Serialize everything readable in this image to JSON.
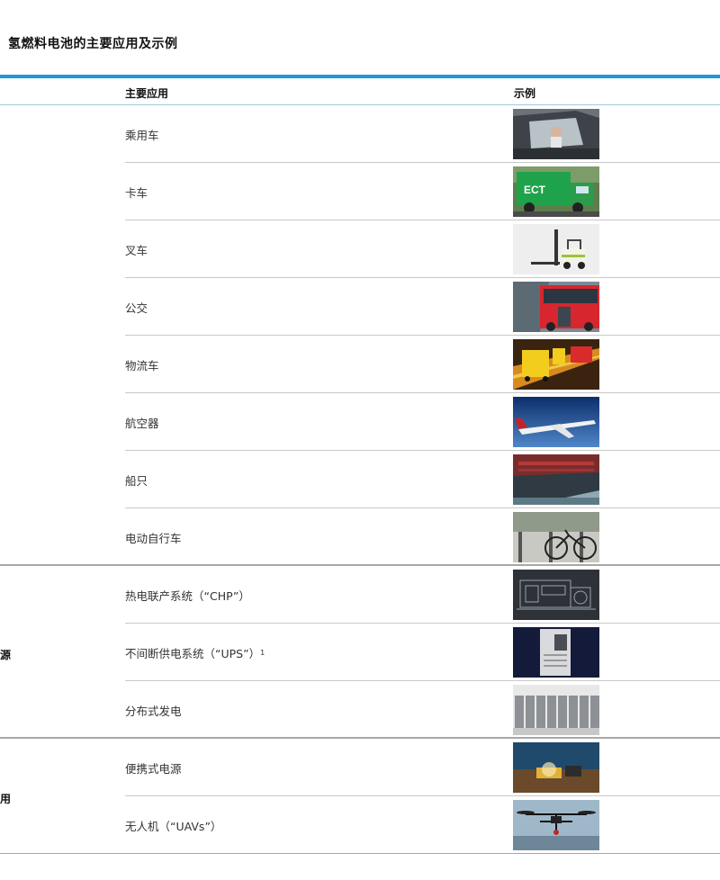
{
  "title": "氢燃料电池的主要应用及示例",
  "header": {
    "app_col": "主要应用",
    "example_col": "示例"
  },
  "categories": [
    {
      "label": "电源"
    },
    {
      "label": "应用"
    }
  ],
  "rows": [
    {
      "label": "乘用车",
      "icon": "car-image"
    },
    {
      "label": "卡车",
      "icon": "truck-image"
    },
    {
      "label": "叉车",
      "icon": "forklift-image"
    },
    {
      "label": "公交",
      "icon": "bus-image"
    },
    {
      "label": "物流车",
      "icon": "logistics-truck-image"
    },
    {
      "label": "航空器",
      "icon": "aircraft-image"
    },
    {
      "label": "船只",
      "icon": "ship-image"
    },
    {
      "label": "电动自行车",
      "icon": "ebike-image"
    },
    {
      "label": "热电联产系统（“CHP”）",
      "icon": "chp-image"
    },
    {
      "label": "不间断供电系统（“UPS”）",
      "sup": "1",
      "icon": "ups-image"
    },
    {
      "label": "分布式发电",
      "icon": "distributed-generation-image"
    },
    {
      "label": "便携式电源",
      "icon": "portable-power-image"
    },
    {
      "label": "无人机（“UAVs”）",
      "icon": "drone-image"
    }
  ]
}
